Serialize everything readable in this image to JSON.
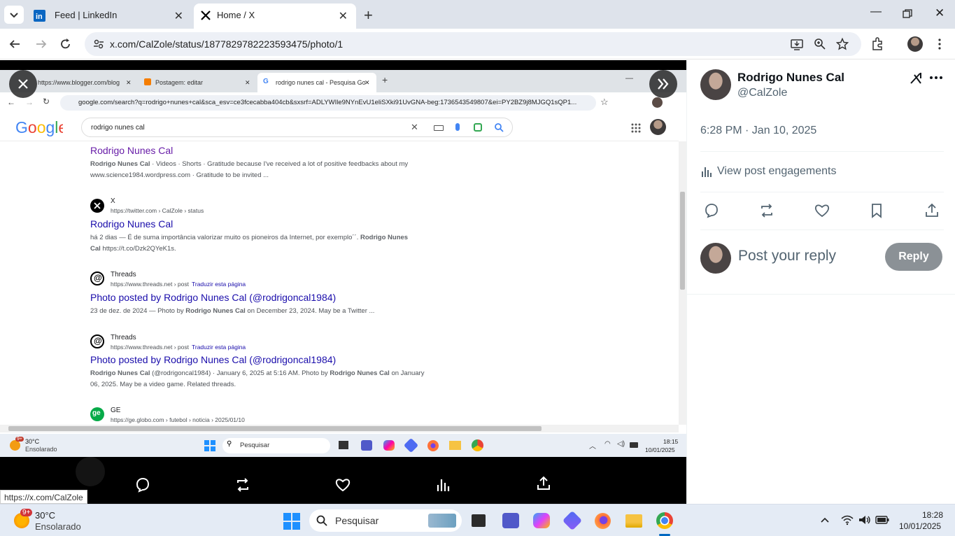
{
  "browser": {
    "tabs": [
      {
        "title": "Feed | LinkedIn"
      },
      {
        "title": "Home / X"
      }
    ],
    "url": "x.com/CalZole/status/1877829782223593475/photo/1"
  },
  "inner": {
    "tabs": [
      {
        "title": "https://www.blogger.com/blog"
      },
      {
        "title": "Postagem: editar"
      },
      {
        "title": "rodrigo nunes cal - Pesquisa Go"
      }
    ],
    "url": "google.com/search?q=rodrigo+nunes+cal&sca_esv=ce3fcecabba404cb&sxsrf=ADLYWIle9NYnEvU1eliSXki91UvGNA-beg:1736543549807&ei=PY2BZ9j8MJGQ1sQP1...",
    "search_query": "rodrigo nunes cal",
    "results": [
      {
        "title": "Rodrigo Nunes Cal",
        "snippet_bold": "Rodrigo Nunes Cal",
        "snippet": " · Videos · Shorts · Gratitude because I've received a lot of positive feedbacks about my www.science1984.wordpress.com · Gratitude to be invited ..."
      },
      {
        "site": "X",
        "url": "https://twitter.com › CalZole › status",
        "title": "Rodrigo Nunes Cal",
        "snippet": "há 2 dias — É de suma importância valorizar muito os pioneiros da Internet, por exemplo´´. ",
        "snippet_bold": "Rodrigo Nunes Cal",
        "snippet_end": " https://t.co/Dzk2QYeK1s."
      },
      {
        "site": "Threads",
        "url": "https://www.threads.net › post",
        "translate": "Traduzir esta página",
        "title": "Photo posted by Rodrigo Nunes Cal (@rodrigoncal1984)",
        "snippet_date": "23 de dez. de 2024",
        "snippet_a": " — Photo by ",
        "snippet_bold": "Rodrigo Nunes Cal",
        "snippet_b": " on December 23, 2024. May be a Twitter ..."
      },
      {
        "site": "Threads",
        "url": "https://www.threads.net › post",
        "translate": "Traduzir esta página",
        "title": "Photo posted by Rodrigo Nunes Cal (@rodrigoncal1984)",
        "snippet_bold": "Rodrigo Nunes Cal",
        "snippet_a": " (@rodrigoncal1984) · January 6, 2025 at 5:16 AM. Photo by ",
        "snippet_bold2": "Rodrigo Nunes Cal",
        "snippet_b": " on January 06, 2025. May be a video game. Related threads."
      },
      {
        "site": "GE",
        "url": "https://ge.globo.com › futebol › noticia › 2025/01/10"
      }
    ],
    "taskbar": {
      "temp": "30°C",
      "weather": "Ensolarado",
      "badge": "9+",
      "search": "Pesquisar",
      "time": "18:15",
      "date": "10/01/2025"
    }
  },
  "status_url": "https://x.com/CalZole",
  "post": {
    "name": "Rodrigo Nunes Cal",
    "handle": "@CalZole",
    "datetime": "6:28 PM · Jan 10, 2025",
    "engagements": "View post engagements",
    "reply_placeholder": "Post your reply",
    "reply_button": "Reply"
  },
  "taskbar": {
    "badge": "9+",
    "temp": "30°C",
    "weather": "Ensolarado",
    "search": "Pesquisar",
    "time": "18:28",
    "date": "10/01/2025"
  },
  "colors": {
    "link": "#1a0dab",
    "visited": "#681da8",
    "x_gray": "#536471",
    "reply_btn": "#8b9196"
  }
}
